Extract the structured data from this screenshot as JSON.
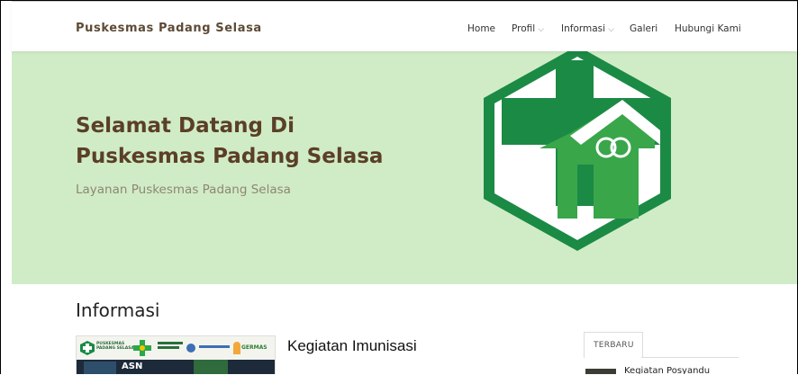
{
  "navbar": {
    "brand": "Puskesmas Padang Selasa",
    "items": [
      {
        "label": "Home",
        "has_dropdown": false
      },
      {
        "label": "Profil",
        "has_dropdown": true
      },
      {
        "label": "Informasi",
        "has_dropdown": true
      },
      {
        "label": "Galeri",
        "has_dropdown": false
      },
      {
        "label": "Hubungi Kami",
        "has_dropdown": false
      }
    ],
    "caret": "⌵"
  },
  "hero": {
    "title_line1": "Selamat Datang Di",
    "title_line2": "Puskesmas Padang Selasa",
    "subtitle": "Layanan Puskesmas Padang Selasa",
    "background_color": "#d0ecc7",
    "logo_icon": "puskesmas-logo-icon"
  },
  "informasi": {
    "section_title": "Informasi",
    "article": {
      "title": "Kegiatan Imunisasi",
      "thumbnail_texts": {
        "logo_line1": "PUSKESMAS",
        "logo_line2": "PADANG SELASA",
        "germas": "GERMAS",
        "asn": "ASN"
      }
    }
  },
  "sidebar": {
    "tab_label": "TERBARU",
    "latest_item_title": "Kegiatan Posyandu"
  },
  "colors": {
    "brand_text": "#5d4a36",
    "hero_title": "#5b3f27",
    "logo_green_dark": "#1b8a45",
    "logo_green_light": "#3aa64a"
  }
}
